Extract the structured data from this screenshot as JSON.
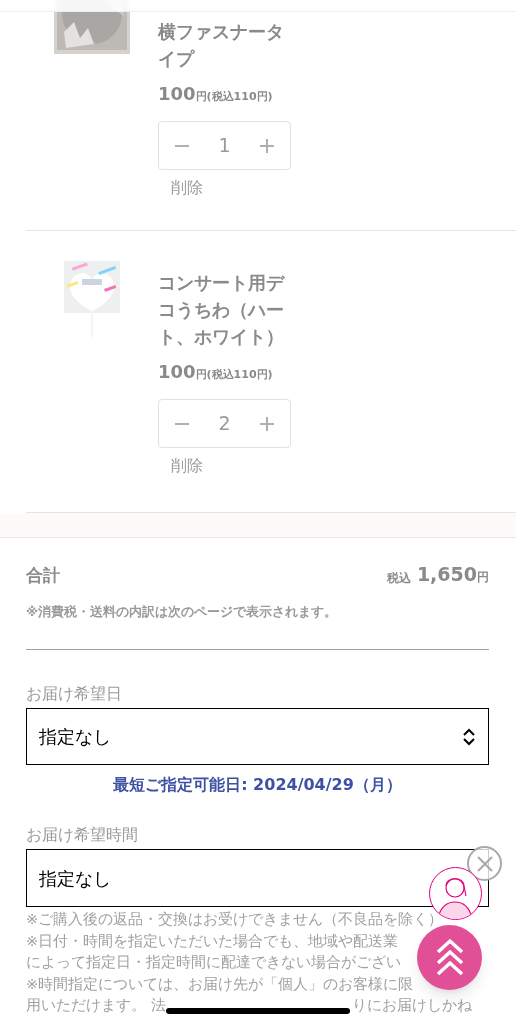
{
  "cart_items": [
    {
      "title": "横ファスナータイプ",
      "price": "100",
      "price_unit": "円",
      "price_tax": "(税込110円)",
      "quantity": "1",
      "remove": "削除"
    },
    {
      "title": "コンサート用デコうちわ（ハート、ホワイト）",
      "price": "100",
      "price_unit": "円",
      "price_tax": "(税込110円)",
      "quantity": "2",
      "remove": "削除"
    }
  ],
  "total": {
    "label": "合計",
    "tax_label": "税込",
    "amount": "1,650",
    "unit": "円",
    "note": "※消費税・送料の内訳は次のページで表示されます。"
  },
  "delivery_date": {
    "label": "お届け希望日",
    "value": "指定なし",
    "earliest": "最短ご指定可能日: 2024/04/29（月）"
  },
  "delivery_time": {
    "label": "お届け希望時間",
    "value": "指定なし"
  },
  "notes": [
    [
      "※ご購入後の返品・交換はお受けできません（不良品を除く）"
    ],
    [
      "※日付・時間を指定いただいた場合でも、地域や配送業"
    ],
    [
      "によって指定日・指定時間に配達できない場合がござい"
    ],
    [
      "※時間指定については、お届け先が「個人」のお客様に限"
    ],
    [
      "用いただけます。 法",
      "りにお届けしかね"
    ]
  ]
}
